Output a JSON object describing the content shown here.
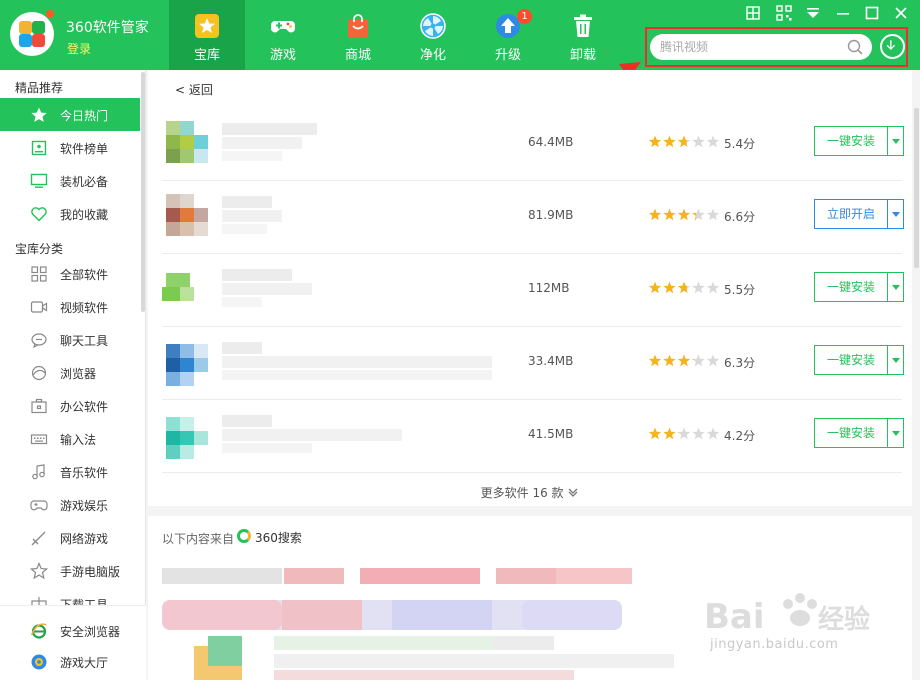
{
  "app": {
    "title": "360软件管家",
    "login": "登录"
  },
  "nav": {
    "tabs": [
      {
        "label": "宝库",
        "active": true
      },
      {
        "label": "游戏"
      },
      {
        "label": "商城"
      },
      {
        "label": "净化"
      },
      {
        "label": "升级",
        "badge": "1"
      },
      {
        "label": "卸载"
      }
    ]
  },
  "search": {
    "placeholder": "腾讯视频"
  },
  "sidebar": {
    "section1": "精品推荐",
    "section2": "宝库分类",
    "items": [
      {
        "label": "今日热门",
        "icon": "star-icon",
        "active": true
      },
      {
        "label": "软件榜单",
        "icon": "ranking-icon"
      },
      {
        "label": "装机必备",
        "icon": "monitor-icon"
      },
      {
        "label": "我的收藏",
        "icon": "heart-icon"
      },
      {
        "label": "全部软件",
        "icon": "grid-icon"
      },
      {
        "label": "视频软件",
        "icon": "video-icon"
      },
      {
        "label": "聊天工具",
        "icon": "chat-icon"
      },
      {
        "label": "浏览器",
        "icon": "browser-icon"
      },
      {
        "label": "办公软件",
        "icon": "briefcase-icon"
      },
      {
        "label": "输入法",
        "icon": "keyboard-icon"
      },
      {
        "label": "音乐软件",
        "icon": "music-icon"
      },
      {
        "label": "游戏娱乐",
        "icon": "gamepad-icon"
      },
      {
        "label": "网络游戏",
        "icon": "sword-icon"
      },
      {
        "label": "手游电脑版",
        "icon": "star-outline-icon"
      },
      {
        "label": "下载工具",
        "icon": "download-icon"
      }
    ],
    "bottom": [
      {
        "label": "安全浏览器",
        "icon": "ie-browser-icon"
      },
      {
        "label": "游戏大厅",
        "icon": "game-hall-icon"
      }
    ]
  },
  "main": {
    "back": "< 返回",
    "apps": [
      {
        "size": "64.4MB",
        "rating": 5.4,
        "score": "5.4分",
        "action": "一键安装",
        "style": "green"
      },
      {
        "size": "81.9MB",
        "rating": 6.6,
        "score": "6.6分",
        "action": "立即开启",
        "style": "blue"
      },
      {
        "size": "112MB",
        "rating": 5.5,
        "score": "5.5分",
        "action": "一键安装",
        "style": "green"
      },
      {
        "size": "33.4MB",
        "rating": 6.3,
        "score": "6.3分",
        "action": "一键安装",
        "style": "green"
      },
      {
        "size": "41.5MB",
        "rating": 4.2,
        "score": "4.2分",
        "action": "一键安装",
        "style": "green"
      }
    ],
    "more": "更多软件 16 款",
    "source_prefix": "以下内容来自",
    "source_name": "360搜索"
  },
  "watermark": {
    "text": "jingyan.baidu.com"
  },
  "colors": {
    "brand": "#23c25a",
    "brand_dark": "#1aa44a",
    "star": "#f5b41f",
    "highlight": "#e8302c",
    "open_button": "#2d8be6"
  }
}
